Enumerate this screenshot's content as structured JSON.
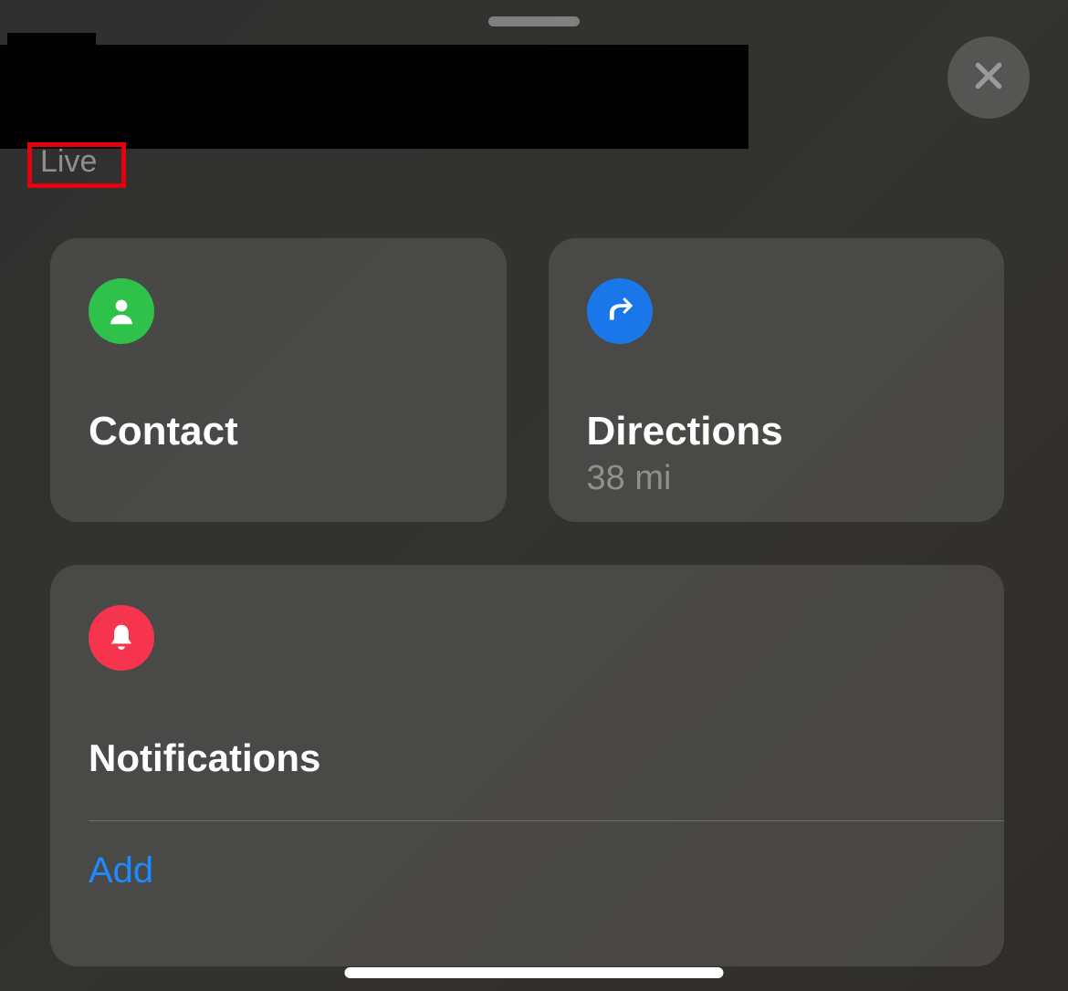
{
  "header": {
    "status_label": "Live"
  },
  "cards": {
    "contact": {
      "title": "Contact"
    },
    "directions": {
      "title": "Directions",
      "subtitle": "38 mi"
    }
  },
  "notifications": {
    "title": "Notifications",
    "add_label": "Add"
  },
  "colors": {
    "green": "#2ec24a",
    "blue": "#1a77ea",
    "red": "#f6344e",
    "link": "#1d8bff"
  }
}
